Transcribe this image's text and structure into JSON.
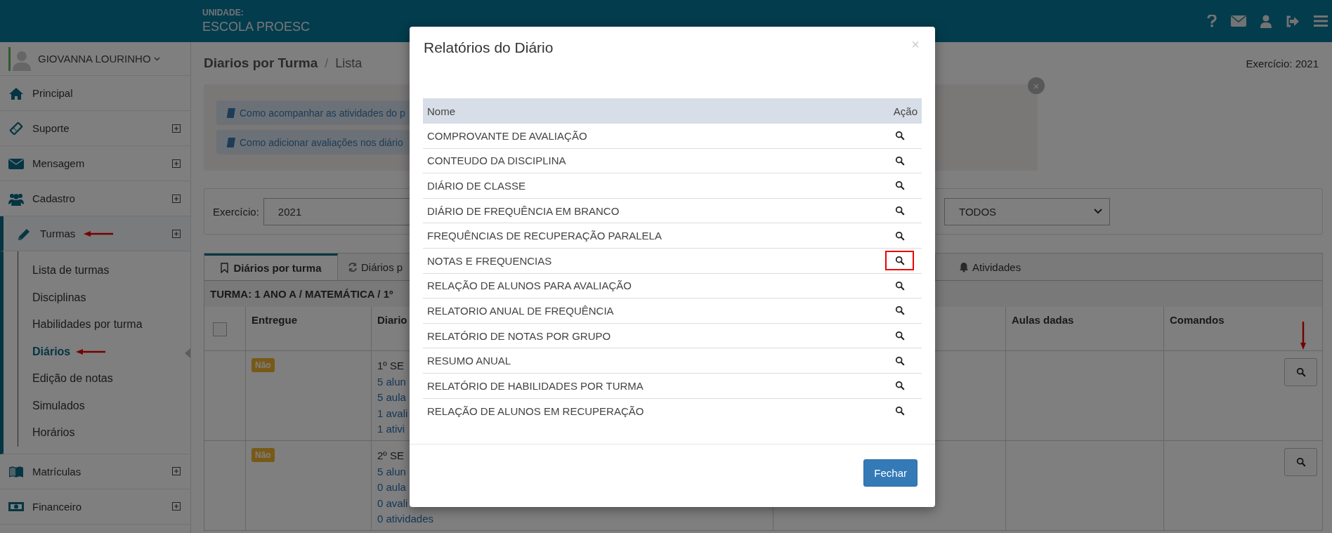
{
  "header": {
    "unit_label": "UNIDADE:",
    "unit_name": "ESCOLA PROESC"
  },
  "sidebar": {
    "user_name": "GIOVANNA LOURINHO",
    "items": [
      {
        "label": "Principal",
        "expandable": false,
        "selected": false,
        "marked": false
      },
      {
        "label": "Suporte",
        "expandable": true,
        "selected": false,
        "marked": false
      },
      {
        "label": "Mensagem",
        "expandable": true,
        "selected": false,
        "marked": false
      },
      {
        "label": "Cadastro",
        "expandable": true,
        "selected": false,
        "marked": false
      },
      {
        "label": "Turmas",
        "expandable": true,
        "selected": true,
        "marked": true,
        "children": [
          {
            "label": "Lista de turmas",
            "selected": false,
            "marked": false
          },
          {
            "label": "Disciplinas",
            "selected": false,
            "marked": false
          },
          {
            "label": "Habilidades por turma",
            "selected": false,
            "marked": false
          },
          {
            "label": "Diários",
            "selected": true,
            "marked": true
          },
          {
            "label": "Edição de notas",
            "selected": false,
            "marked": false
          },
          {
            "label": "Simulados",
            "selected": false,
            "marked": false
          },
          {
            "label": "Horários",
            "selected": false,
            "marked": false
          }
        ]
      },
      {
        "label": "Matrículas",
        "expandable": true,
        "selected": false,
        "marked": false
      },
      {
        "label": "Financeiro",
        "expandable": true,
        "selected": false,
        "marked": false
      }
    ]
  },
  "page": {
    "title": "Diarios por Turma",
    "separator": "/",
    "subtitle": "Lista",
    "exercise": "Exercício: 2021"
  },
  "info_close": "×",
  "help_links": [
    "Como acompanhar as atividades do p",
    "Como adicionar avaliações nos diário"
  ],
  "filters": [
    {
      "label": "Exercício:",
      "value": "2021"
    },
    {
      "value": "TODOS"
    }
  ],
  "tabs": [
    {
      "label": "Diários por turma",
      "selected": true
    },
    {
      "label": "Diários p",
      "selected": false
    },
    {
      "label": "Atividades",
      "selected": false
    }
  ],
  "table": {
    "caption": "TURMA: 1 ANO A / MATEMÁTICA / 1º",
    "select_all_checked": false,
    "columns": [
      "Entregue",
      "Diario",
      "",
      "Aulas dadas",
      "Comandos"
    ],
    "rows": [
      {
        "delivered": "Não",
        "diary_title": "1º SE",
        "diary_links": [
          "5 alun",
          "5 aula",
          "1 avali",
          "1 ativi"
        ],
        "marked": true
      },
      {
        "delivered": "Não",
        "diary_title": "2º SE",
        "diary_links": [
          "5 alun",
          "0 aula",
          "0 avali",
          "0 atividades"
        ],
        "marked": false
      }
    ]
  },
  "modal": {
    "title": "Relatórios do Diário",
    "close": "×",
    "columns": [
      "Nome",
      "Ação"
    ],
    "rows": [
      {
        "name": "COMPROVANTE DE AVALIAÇÃO",
        "highlighted": false
      },
      {
        "name": "CONTEUDO DA DISCIPLINA",
        "highlighted": false
      },
      {
        "name": "DIÁRIO DE CLASSE",
        "highlighted": false
      },
      {
        "name": "DIÁRIO DE FREQUÊNCIA EM BRANCO",
        "highlighted": false
      },
      {
        "name": "FREQUÊNCIAS DE RECUPERAÇÃO PARALELA",
        "highlighted": false
      },
      {
        "name": "NOTAS E FREQUENCIAS",
        "highlighted": true
      },
      {
        "name": "RELAÇÃO DE ALUNOS PARA AVALIAÇÃO",
        "highlighted": false
      },
      {
        "name": "RELATORIO ANUAL DE FREQUÊNCIA",
        "highlighted": false
      },
      {
        "name": "RELATÓRIO DE NOTAS POR GRUPO",
        "highlighted": false
      },
      {
        "name": "RESUMO ANUAL",
        "highlighted": false
      },
      {
        "name": "RELATÓRIO DE HABILIDADES POR TURMA",
        "highlighted": false
      },
      {
        "name": "RELAÇÃO DE ALUNOS EM RECUPERAÇÃO",
        "highlighted": false
      }
    ],
    "button": "Fechar"
  }
}
